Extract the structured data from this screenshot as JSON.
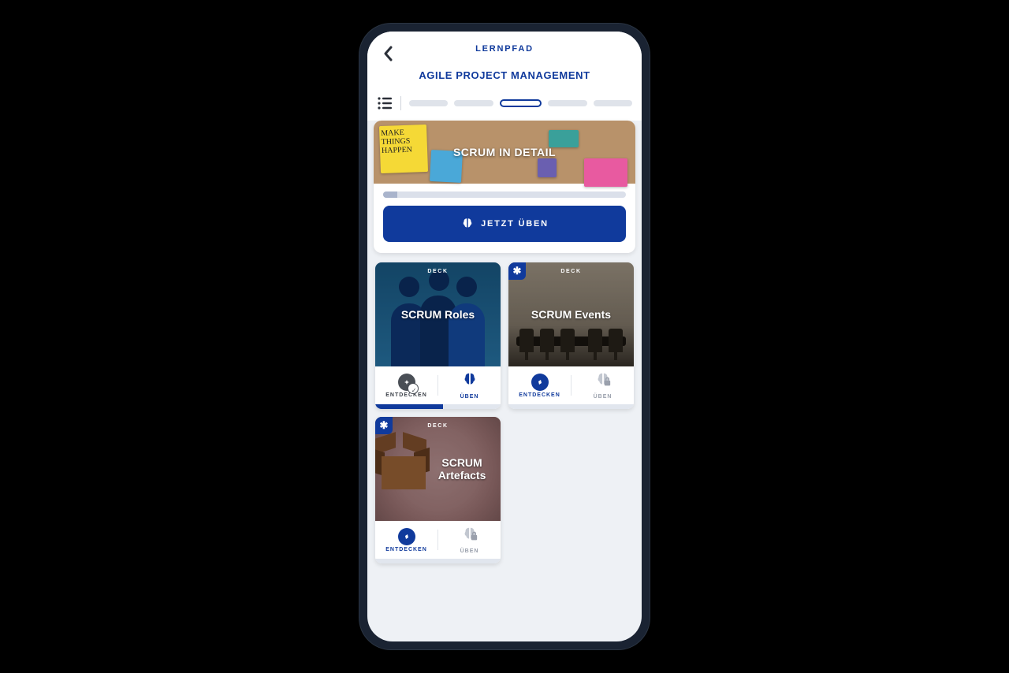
{
  "header": {
    "breadcrumb": "LERNPFAD",
    "title": "AGILE PROJECT MANAGEMENT"
  },
  "progress": {
    "segments": 5,
    "active_index": 2
  },
  "hero": {
    "sticky_note_text": "MAKE THINGS HAPPEN",
    "title": "SCRUM IN DETAIL",
    "cta_label": "JETZT ÜBEN"
  },
  "deck_type_label": "DECK",
  "actions": {
    "discover": "ENTDECKEN",
    "practice": "ÜBEN"
  },
  "decks": [
    {
      "title": "SCRUM Roles",
      "discover_done": true,
      "practice_enabled": true,
      "progress_pct": 54,
      "badge": false
    },
    {
      "title": "SCRUM Events",
      "discover_done": false,
      "practice_enabled": false,
      "progress_pct": 0,
      "badge": true
    },
    {
      "title": "SCRUM Artefacts",
      "discover_done": false,
      "practice_enabled": false,
      "progress_pct": 0,
      "badge": true
    }
  ]
}
